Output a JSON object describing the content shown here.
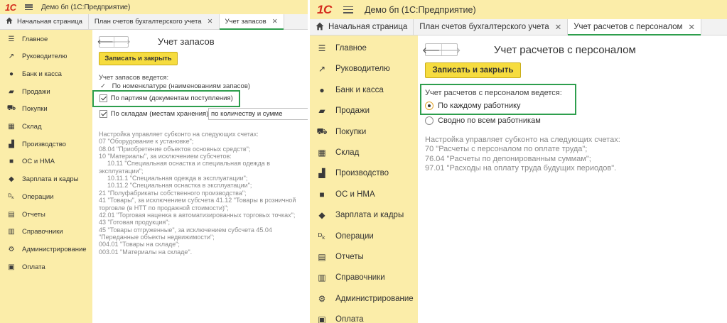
{
  "left": {
    "app_title": "Демо бп   (1С:Предприятие)",
    "logo": "1С",
    "tabs": [
      {
        "label": "Начальная страница"
      },
      {
        "label": "План счетов бухгалтерского учета"
      },
      {
        "label": "Учет запасов"
      }
    ],
    "sidebar": [
      {
        "icon": "menu-lines-icon",
        "label": "Главное"
      },
      {
        "icon": "trend-icon",
        "label": "Руководителю"
      },
      {
        "icon": "ruble-coin-icon",
        "label": "Банк и касса"
      },
      {
        "icon": "shopping-bag-icon",
        "label": "Продажи"
      },
      {
        "icon": "cart-icon",
        "label": "Покупки"
      },
      {
        "icon": "warehouse-icon",
        "label": "Склад"
      },
      {
        "icon": "factory-icon",
        "label": "Производство"
      },
      {
        "icon": "truck-icon",
        "label": "ОС и НМА"
      },
      {
        "icon": "people-icon",
        "label": "Зарплата и кадры"
      },
      {
        "icon": "dt-kt-icon",
        "label": "Операции"
      },
      {
        "icon": "report-icon",
        "label": "Отчеты"
      },
      {
        "icon": "books-icon",
        "label": "Справочники"
      },
      {
        "icon": "gear-icon",
        "label": "Администрирование"
      },
      {
        "icon": "payment-icon",
        "label": "Оплата"
      }
    ],
    "form_title": "Учет запасов",
    "save_label": "Записать и закрыть",
    "section_label": "Учет запасов ведется:",
    "opt_nomenclature": "По номенклатуре (наименованиям запасов)",
    "opt_batches": "По партиям (документам поступления)",
    "opt_warehouses": "По складам (местам хранения):",
    "warehouse_select": "по количеству и сумме",
    "info_lines": [
      "Настройка управляет субконто на следующих счетах:",
      "07 \"Оборудование к установке\";",
      "08.04 \"Приобретение объектов основных средств\";",
      "10 \"Материалы\", за исключением субсчетов:",
      "10.11 \"Специальная оснастка и специальная одежда в",
      "эксплуатации\";",
      "10.11.1 \"Специальная одежда в эксплуатации\";",
      "10.11.2 \"Специальная оснастка в эксплуатации\";",
      "21 \"Полуфабрикаты собственного производства\";",
      "41 \"Товары\", за исключением субсчета 41.12 \"Товары в розничной",
      "торговле (в НТТ по продажной стоимости)\";",
      "42.01 \"Торговая наценка в автоматизированных торговых точках\";",
      "43 \"Готовая продукция\";",
      "45 \"Товары отгруженные\", за исключением субсчета 45.04",
      "\"Переданные объекты недвижимости\";",
      "004.01 \"Товары на складе\";",
      "003.01 \"Материалы на складе\"."
    ]
  },
  "right": {
    "app_title": "Демо бп   (1С:Предприятие)",
    "logo": "1С",
    "tabs": [
      {
        "label": "Начальная страница"
      },
      {
        "label": "План счетов бухгалтерского учета"
      },
      {
        "label": "Учет расчетов с персоналом"
      }
    ],
    "sidebar": [
      {
        "icon": "menu-lines-icon",
        "label": "Главное"
      },
      {
        "icon": "trend-icon",
        "label": "Руководителю"
      },
      {
        "icon": "ruble-coin-icon",
        "label": "Банк и касса"
      },
      {
        "icon": "shopping-bag-icon",
        "label": "Продажи"
      },
      {
        "icon": "cart-icon",
        "label": "Покупки"
      },
      {
        "icon": "warehouse-icon",
        "label": "Склад"
      },
      {
        "icon": "factory-icon",
        "label": "Производство"
      },
      {
        "icon": "truck-icon",
        "label": "ОС и НМА"
      },
      {
        "icon": "people-icon",
        "label": "Зарплата и кадры"
      },
      {
        "icon": "dt-kt-icon",
        "label": "Операции"
      },
      {
        "icon": "report-icon",
        "label": "Отчеты"
      },
      {
        "icon": "books-icon",
        "label": "Справочники"
      },
      {
        "icon": "gear-icon",
        "label": "Администрирование"
      },
      {
        "icon": "payment-icon",
        "label": "Оплата"
      }
    ],
    "form_title": "Учет расчетов с персоналом",
    "save_label": "Записать и закрыть",
    "section_label": "Учет расчетов с персоналом ведется:",
    "opt_each": "По каждому работнику",
    "opt_summary": "Сводно по всем работникам",
    "info_lines": [
      "Настройка управляет субконто на следующих счетах:",
      "70 \"Расчеты с персоналом по оплате труда\";",
      "76.04 \"Расчеты по депонированным суммам\";",
      "97.01 \"Расходы на оплату труда будущих периодов\"."
    ]
  }
}
